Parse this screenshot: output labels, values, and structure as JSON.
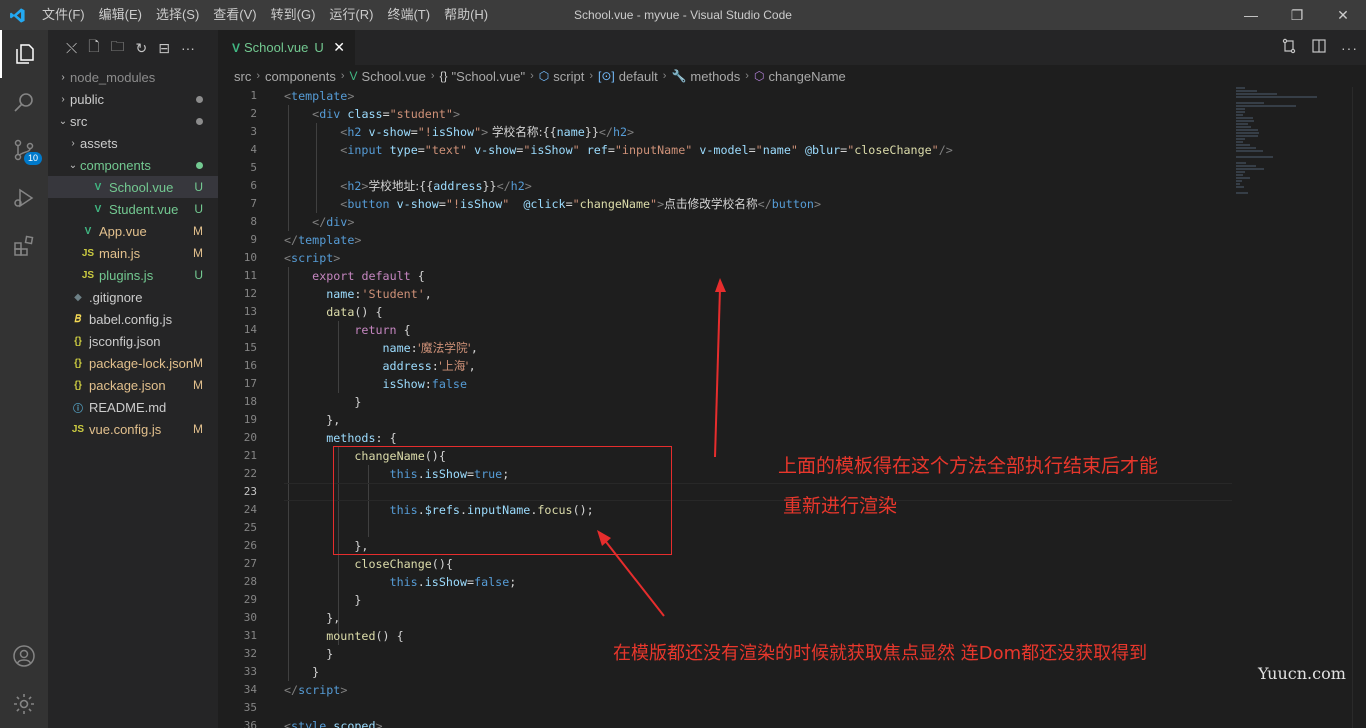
{
  "titlebar": {
    "menu": [
      "文件(F)",
      "编辑(E)",
      "选择(S)",
      "查看(V)",
      "转到(G)",
      "运行(R)",
      "终端(T)",
      "帮助(H)"
    ],
    "title": "School.vue - myvue - Visual Studio Code",
    "minimize": "—",
    "restore": "❐",
    "close": "✕"
  },
  "activity": {
    "scm_badge": "10"
  },
  "sidebar": {
    "tools": [
      "⤬",
      "🗋",
      "🗀",
      "↻",
      "⊟",
      "···"
    ],
    "items": [
      {
        "label": "node_modules",
        "chev": "›",
        "indent": 1,
        "icon": "",
        "color": "#8c8c8c",
        "status": "",
        "icon_color": "#c5c5c5"
      },
      {
        "label": "public",
        "chev": "›",
        "indent": 1,
        "icon": "",
        "color": "#cccccc",
        "status": "dot",
        "status_color": "#8c8c8c",
        "icon_color": "#c5c5c5"
      },
      {
        "label": "src",
        "chev": "⌄",
        "indent": 1,
        "icon": "",
        "color": "#cccccc",
        "status": "dot",
        "status_color": "#8c8c8c",
        "icon_color": "#c5c5c5"
      },
      {
        "label": "assets",
        "chev": "›",
        "indent": 2,
        "icon": "",
        "color": "#cccccc",
        "status": "",
        "icon_color": "#c5c5c5"
      },
      {
        "label": "components",
        "chev": "⌄",
        "indent": 2,
        "icon": "",
        "color": "#73c991",
        "status": "dot",
        "status_color": "#73c991",
        "icon_color": "#c5c5c5"
      },
      {
        "label": "School.vue",
        "chev": "",
        "indent": 3,
        "icon": "V",
        "color": "#73c991",
        "status": "U",
        "status_color": "#73c991",
        "icon_color": "#41b883",
        "selected": true
      },
      {
        "label": "Student.vue",
        "chev": "",
        "indent": 3,
        "icon": "V",
        "color": "#73c991",
        "status": "U",
        "status_color": "#73c991",
        "icon_color": "#41b883"
      },
      {
        "label": "App.vue",
        "chev": "",
        "indent": 2,
        "icon": "V",
        "color": "#e2c08d",
        "status": "M",
        "status_color": "#e2c08d",
        "icon_color": "#41b883"
      },
      {
        "label": "main.js",
        "chev": "",
        "indent": 2,
        "icon": "JS",
        "color": "#e2c08d",
        "status": "M",
        "status_color": "#e2c08d",
        "icon_color": "#cbcb41"
      },
      {
        "label": "plugins.js",
        "chev": "",
        "indent": 2,
        "icon": "JS",
        "color": "#73c991",
        "status": "U",
        "status_color": "#73c991",
        "icon_color": "#cbcb41"
      },
      {
        "label": ".gitignore",
        "chev": "",
        "indent": 1,
        "icon": "◆",
        "color": "#cccccc",
        "status": "",
        "icon_color": "#6d8086"
      },
      {
        "label": "babel.config.js",
        "chev": "",
        "indent": 1,
        "icon": "𝐵",
        "color": "#cccccc",
        "status": "",
        "icon_color": "#f5da55"
      },
      {
        "label": "jsconfig.json",
        "chev": "",
        "indent": 1,
        "icon": "{}",
        "color": "#cccccc",
        "status": "",
        "icon_color": "#cbcb41"
      },
      {
        "label": "package-lock.json",
        "chev": "",
        "indent": 1,
        "icon": "{}",
        "color": "#e2c08d",
        "status": "M",
        "status_color": "#e2c08d",
        "icon_color": "#cbcb41"
      },
      {
        "label": "package.json",
        "chev": "",
        "indent": 1,
        "icon": "{}",
        "color": "#e2c08d",
        "status": "M",
        "status_color": "#e2c08d",
        "icon_color": "#cbcb41"
      },
      {
        "label": "README.md",
        "chev": "",
        "indent": 1,
        "icon": "ⓘ",
        "color": "#cccccc",
        "status": "",
        "icon_color": "#519aba"
      },
      {
        "label": "vue.config.js",
        "chev": "",
        "indent": 1,
        "icon": "JS",
        "color": "#e2c08d",
        "status": "M",
        "status_color": "#e2c08d",
        "icon_color": "#cbcb41"
      }
    ]
  },
  "tab": {
    "icon": "V",
    "name": "School.vue",
    "status": "U",
    "close": "✕"
  },
  "breadcrumb": [
    "src",
    "components",
    "School.vue",
    "\"School.vue\"",
    "script",
    "default",
    "methods",
    "changeName"
  ],
  "editor": {
    "current_line": 23,
    "lines": [
      [
        [
          "c-brk",
          "<"
        ],
        [
          "c-tag",
          "template"
        ],
        [
          "c-brk",
          ">"
        ]
      ],
      [
        [
          "c-txt",
          "    "
        ],
        [
          "c-brk",
          "<"
        ],
        [
          "c-tag",
          "div"
        ],
        [
          "c-txt",
          " "
        ],
        [
          "c-attr",
          "class"
        ],
        [
          "c-txt",
          "="
        ],
        [
          "c-str",
          "\"student\""
        ],
        [
          "c-brk",
          ">"
        ]
      ],
      [
        [
          "c-txt",
          "        "
        ],
        [
          "c-brk",
          "<"
        ],
        [
          "c-tag",
          "h2"
        ],
        [
          "c-txt",
          " "
        ],
        [
          "c-attr",
          "v-show"
        ],
        [
          "c-txt",
          "="
        ],
        [
          "c-str",
          "\"!"
        ],
        [
          "c-var",
          "isShow"
        ],
        [
          "c-str",
          "\""
        ],
        [
          "c-brk",
          ">"
        ],
        [
          "c-txt c-cjk",
          " 学校名称:"
        ],
        [
          "c-txt",
          "{{"
        ],
        [
          "c-var",
          "name"
        ],
        [
          "c-txt",
          "}}"
        ],
        [
          "c-brk",
          "</"
        ],
        [
          "c-tag",
          "h2"
        ],
        [
          "c-brk",
          ">"
        ]
      ],
      [
        [
          "c-txt",
          "        "
        ],
        [
          "c-brk",
          "<"
        ],
        [
          "c-tag",
          "input"
        ],
        [
          "c-txt",
          " "
        ],
        [
          "c-attr",
          "type"
        ],
        [
          "c-txt",
          "="
        ],
        [
          "c-str",
          "\"text\""
        ],
        [
          "c-txt",
          " "
        ],
        [
          "c-attr",
          "v-show"
        ],
        [
          "c-txt",
          "="
        ],
        [
          "c-str",
          "\""
        ],
        [
          "c-var",
          "isShow"
        ],
        [
          "c-str",
          "\""
        ],
        [
          "c-txt",
          " "
        ],
        [
          "c-attr",
          "ref"
        ],
        [
          "c-txt",
          "="
        ],
        [
          "c-str",
          "\"inputName\""
        ],
        [
          "c-txt",
          " "
        ],
        [
          "c-attr",
          "v-model"
        ],
        [
          "c-txt",
          "="
        ],
        [
          "c-str",
          "\""
        ],
        [
          "c-var",
          "name"
        ],
        [
          "c-str",
          "\""
        ],
        [
          "c-txt",
          " "
        ],
        [
          "c-attr",
          "@blur"
        ],
        [
          "c-txt",
          "="
        ],
        [
          "c-str",
          "\""
        ],
        [
          "c-fn",
          "closeChange"
        ],
        [
          "c-str",
          "\""
        ],
        [
          "c-brk",
          "/>"
        ]
      ],
      [
        [
          "c-txt",
          ""
        ]
      ],
      [
        [
          "c-txt",
          "        "
        ],
        [
          "c-brk",
          "<"
        ],
        [
          "c-tag",
          "h2"
        ],
        [
          "c-brk",
          ">"
        ],
        [
          "c-txt c-cjk",
          "学校地址:"
        ],
        [
          "c-txt",
          "{{"
        ],
        [
          "c-var",
          "address"
        ],
        [
          "c-txt",
          "}}"
        ],
        [
          "c-brk",
          "</"
        ],
        [
          "c-tag",
          "h2"
        ],
        [
          "c-brk",
          ">"
        ]
      ],
      [
        [
          "c-txt",
          "        "
        ],
        [
          "c-brk",
          "<"
        ],
        [
          "c-tag",
          "button"
        ],
        [
          "c-txt",
          " "
        ],
        [
          "c-attr",
          "v-show"
        ],
        [
          "c-txt",
          "="
        ],
        [
          "c-str",
          "\"!"
        ],
        [
          "c-var",
          "isShow"
        ],
        [
          "c-str",
          "\""
        ],
        [
          "c-txt",
          "  "
        ],
        [
          "c-attr",
          "@click"
        ],
        [
          "c-txt",
          "="
        ],
        [
          "c-str",
          "\""
        ],
        [
          "c-fn",
          "changeName"
        ],
        [
          "c-str",
          "\""
        ],
        [
          "c-brk",
          ">"
        ],
        [
          "c-txt c-cjk",
          "点击修改学校名称"
        ],
        [
          "c-brk",
          "</"
        ],
        [
          "c-tag",
          "button"
        ],
        [
          "c-brk",
          ">"
        ]
      ],
      [
        [
          "c-txt",
          "    "
        ],
        [
          "c-brk",
          "</"
        ],
        [
          "c-tag",
          "div"
        ],
        [
          "c-brk",
          ">"
        ]
      ],
      [
        [
          "c-brk",
          "</"
        ],
        [
          "c-tag",
          "template"
        ],
        [
          "c-brk",
          ">"
        ]
      ],
      [
        [
          "c-brk",
          "<"
        ],
        [
          "c-tag",
          "script"
        ],
        [
          "c-brk",
          ">"
        ]
      ],
      [
        [
          "c-txt",
          "    "
        ],
        [
          "c-kw",
          "export"
        ],
        [
          "c-txt",
          " "
        ],
        [
          "c-kw",
          "default"
        ],
        [
          "c-txt",
          " {"
        ]
      ],
      [
        [
          "c-txt",
          "      "
        ],
        [
          "c-var",
          "name"
        ],
        [
          "c-txt",
          ":"
        ],
        [
          "c-str",
          "'Student'"
        ],
        [
          "c-txt",
          ","
        ]
      ],
      [
        [
          "c-txt",
          "      "
        ],
        [
          "c-fn",
          "data"
        ],
        [
          "c-txt",
          "() {"
        ]
      ],
      [
        [
          "c-txt",
          "          "
        ],
        [
          "c-kw",
          "return"
        ],
        [
          "c-txt",
          " {"
        ]
      ],
      [
        [
          "c-txt",
          "              "
        ],
        [
          "c-var",
          "name"
        ],
        [
          "c-txt",
          ":"
        ],
        [
          "c-str c-cjk",
          "'魔法学院'"
        ],
        [
          "c-txt",
          ","
        ]
      ],
      [
        [
          "c-txt",
          "              "
        ],
        [
          "c-var",
          "address"
        ],
        [
          "c-txt",
          ":"
        ],
        [
          "c-str c-cjk",
          "'上海'"
        ],
        [
          "c-txt",
          ","
        ]
      ],
      [
        [
          "c-txt",
          "              "
        ],
        [
          "c-var",
          "isShow"
        ],
        [
          "c-txt",
          ":"
        ],
        [
          "c-const",
          "false"
        ]
      ],
      [
        [
          "c-txt",
          "          }"
        ]
      ],
      [
        [
          "c-txt",
          "      },"
        ]
      ],
      [
        [
          "c-txt",
          "      "
        ],
        [
          "c-var",
          "methods"
        ],
        [
          "c-txt",
          ": {"
        ]
      ],
      [
        [
          "c-txt",
          "          "
        ],
        [
          "c-fn",
          "changeName"
        ],
        [
          "c-txt",
          "(){"
        ]
      ],
      [
        [
          "c-txt",
          "               "
        ],
        [
          "c-this",
          "this"
        ],
        [
          "c-txt",
          "."
        ],
        [
          "c-var",
          "isShow"
        ],
        [
          "c-txt",
          "="
        ],
        [
          "c-const",
          "true"
        ],
        [
          "c-txt",
          ";"
        ]
      ],
      [
        [
          "c-txt",
          ""
        ]
      ],
      [
        [
          "c-txt",
          "               "
        ],
        [
          "c-this",
          "this"
        ],
        [
          "c-txt",
          "."
        ],
        [
          "c-var",
          "$refs"
        ],
        [
          "c-txt",
          "."
        ],
        [
          "c-var",
          "inputName"
        ],
        [
          "c-txt",
          "."
        ],
        [
          "c-fn",
          "focus"
        ],
        [
          "c-txt",
          "();"
        ]
      ],
      [
        [
          "c-txt",
          ""
        ]
      ],
      [
        [
          "c-txt",
          "          },"
        ]
      ],
      [
        [
          "c-txt",
          "          "
        ],
        [
          "c-fn",
          "closeChange"
        ],
        [
          "c-txt",
          "(){"
        ]
      ],
      [
        [
          "c-txt",
          "               "
        ],
        [
          "c-this",
          "this"
        ],
        [
          "c-txt",
          "."
        ],
        [
          "c-var",
          "isShow"
        ],
        [
          "c-txt",
          "="
        ],
        [
          "c-const",
          "false"
        ],
        [
          "c-txt",
          ";"
        ]
      ],
      [
        [
          "c-txt",
          "          }"
        ]
      ],
      [
        [
          "c-txt",
          "      },"
        ]
      ],
      [
        [
          "c-txt",
          "      "
        ],
        [
          "c-fn",
          "mounted"
        ],
        [
          "c-txt",
          "() {"
        ]
      ],
      [
        [
          "c-txt",
          "      }"
        ]
      ],
      [
        [
          "c-txt",
          "    }"
        ]
      ],
      [
        [
          "c-brk",
          "</"
        ],
        [
          "c-tag",
          "script"
        ],
        [
          "c-brk",
          ">"
        ]
      ],
      [
        [
          "c-txt",
          ""
        ]
      ],
      [
        [
          "c-brk",
          "<"
        ],
        [
          "c-tag",
          "style"
        ],
        [
          "c-txt",
          " "
        ],
        [
          "c-attr",
          "scoped"
        ],
        [
          "c-brk",
          ">"
        ]
      ]
    ]
  },
  "annotations": {
    "top_line1": "上面的模板得在这个方法全部执行结束后才能",
    "top_line2": "重新进行渲染",
    "bottom": "在模版都还没有渲染的时候就获取焦点显然 连Dom都还没获取得到",
    "color": "#e8372c"
  },
  "watermark": "Yuucn.com"
}
